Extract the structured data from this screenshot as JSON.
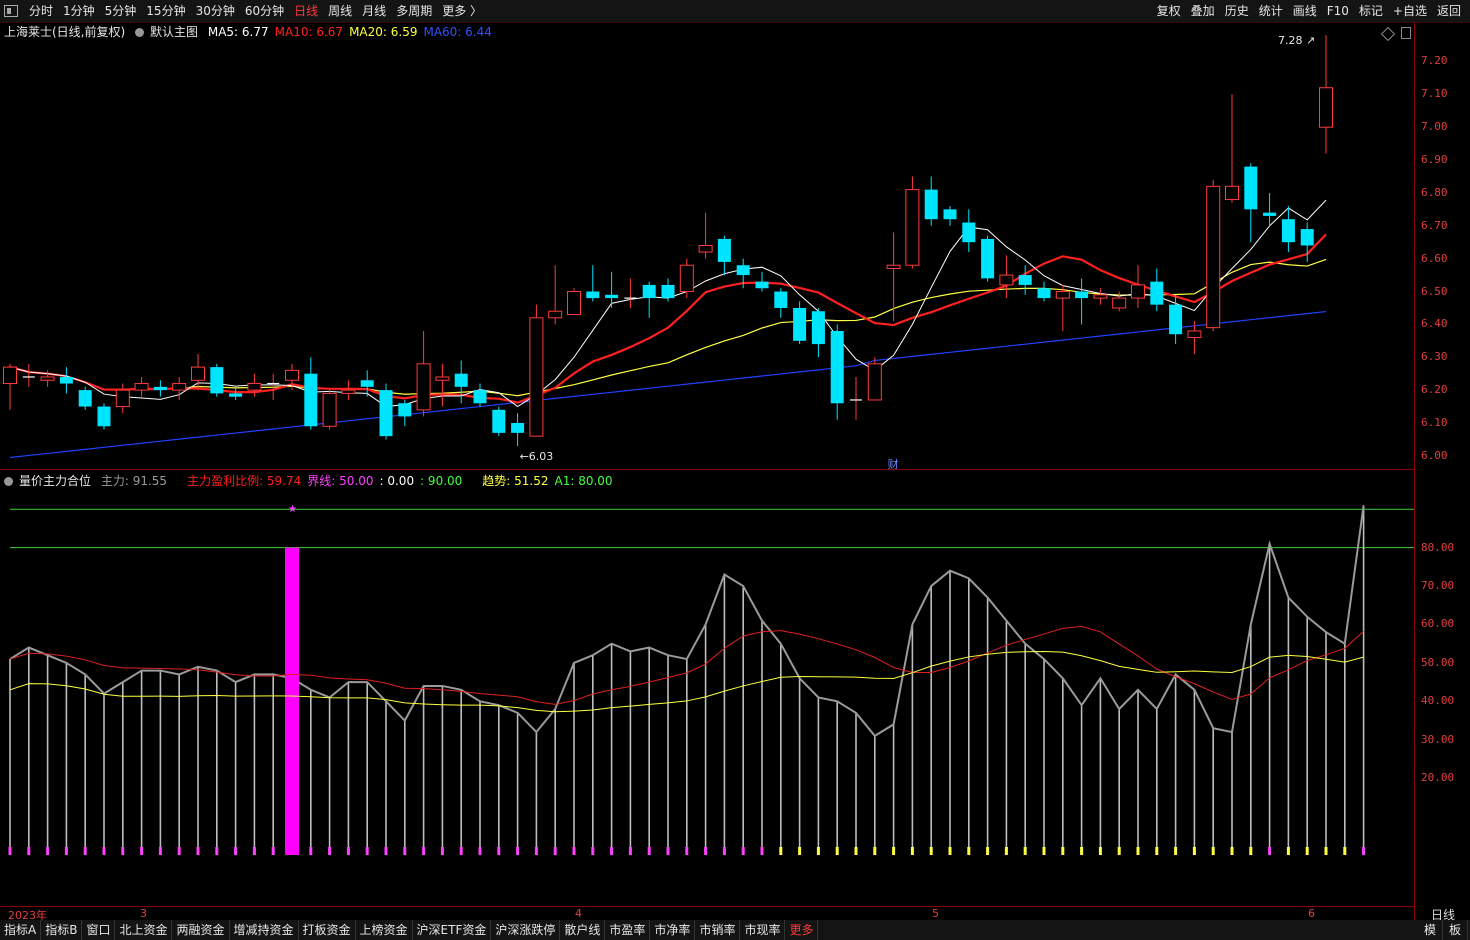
{
  "toolbar": {
    "periods": [
      "分时",
      "1分钟",
      "5分钟",
      "15分钟",
      "30分钟",
      "60分钟",
      "日线",
      "周线",
      "月线",
      "多周期",
      "更多 〉"
    ],
    "active_period": "日线",
    "right_buttons": [
      "复权",
      "叠加",
      "历史",
      "统计",
      "画线",
      "F10",
      "标记",
      "+自选",
      "返回"
    ]
  },
  "price_panel": {
    "stock_title": "上海莱士(日线,前复权)",
    "template": "默认主图",
    "ma": [
      {
        "label": "MA5: 6.77",
        "color": "#ffffff"
      },
      {
        "label": "MA10: 6.67",
        "color": "#ff2020"
      },
      {
        "label": "MA20: 6.59",
        "color": "#ffff40"
      },
      {
        "label": "MA60: 6.44",
        "color": "#3050ff"
      }
    ],
    "high_label": "7.28",
    "low_label": "6.03",
    "finance_marker": "财",
    "y_ticks": [
      "7.20",
      "7.10",
      "7.00",
      "6.90",
      "6.80",
      "6.70",
      "6.60",
      "6.50",
      "6.40",
      "6.30",
      "6.20",
      "6.10",
      "6.00"
    ]
  },
  "indicator_panel": {
    "name": "量价主力合位",
    "items": [
      {
        "label": "主力: 91.55",
        "color": "#9a9a9a"
      },
      {
        "label": "主力盈利比例: 59.74",
        "color": "#ff2020"
      },
      {
        "label": "界线: 50.00",
        "color": "#ff40ff"
      },
      {
        "label": ": 0.00",
        "color": "#ffffff"
      },
      {
        "label": ": 90.00",
        "color": "#40ff40"
      },
      {
        "label": "趋势: 51.52",
        "color": "#ffff40"
      },
      {
        "label": "A1: 80.00",
        "color": "#40ff40"
      }
    ],
    "y_ticks": [
      "80.00",
      "70.00",
      "60.00",
      "50.00",
      "40.00",
      "30.00",
      "20.00"
    ]
  },
  "dates": {
    "labels": [
      {
        "text": "2023年"
      },
      {
        "text": "3"
      },
      {
        "text": "4"
      },
      {
        "text": "5"
      },
      {
        "text": "6"
      }
    ],
    "period": "日线"
  },
  "bottom_bar": {
    "items": [
      "指标A",
      "指标B",
      "窗口",
      "北上资金",
      "两融资金",
      "增减持资金",
      "打板资金",
      "上榜资金",
      "沪深ETF资金",
      "沪深涨跌停",
      "散户线",
      "市盈率",
      "市净率",
      "市销率",
      "市现率",
      "更多"
    ],
    "right": [
      "模",
      "板"
    ]
  },
  "chart_data": [
    {
      "type": "candlestick",
      "title": "上海莱士(日线,前复权)",
      "ylim": [
        5.96,
        7.32
      ],
      "candles": [
        [
          6.22,
          6.27,
          6.14,
          6.28
        ],
        [
          6.24,
          6.24,
          6.21,
          6.28
        ],
        [
          6.23,
          6.24,
          6.21,
          6.26
        ],
        [
          6.24,
          6.22,
          6.19,
          6.27
        ],
        [
          6.2,
          6.15,
          6.14,
          6.21
        ],
        [
          6.15,
          6.09,
          6.08,
          6.16
        ],
        [
          6.15,
          6.2,
          6.13,
          6.22
        ],
        [
          6.2,
          6.22,
          6.18,
          6.24
        ],
        [
          6.21,
          6.2,
          6.18,
          6.23
        ],
        [
          6.2,
          6.22,
          6.17,
          6.24
        ],
        [
          6.23,
          6.27,
          6.2,
          6.31
        ],
        [
          6.27,
          6.19,
          6.18,
          6.28
        ],
        [
          6.19,
          6.18,
          6.17,
          6.21
        ],
        [
          6.2,
          6.22,
          6.18,
          6.25
        ],
        [
          6.22,
          6.22,
          6.17,
          6.25
        ],
        [
          6.23,
          6.26,
          6.2,
          6.28
        ],
        [
          6.25,
          6.09,
          6.08,
          6.3
        ],
        [
          6.09,
          6.19,
          6.08,
          6.2
        ],
        [
          6.19,
          6.2,
          6.17,
          6.23
        ],
        [
          6.23,
          6.21,
          6.18,
          6.26
        ],
        [
          6.2,
          6.06,
          6.05,
          6.22
        ],
        [
          6.16,
          6.12,
          6.09,
          6.17
        ],
        [
          6.14,
          6.28,
          6.12,
          6.38
        ],
        [
          6.23,
          6.24,
          6.15,
          6.28
        ],
        [
          6.25,
          6.21,
          6.16,
          6.29
        ],
        [
          6.2,
          6.16,
          6.15,
          6.22
        ],
        [
          6.14,
          6.07,
          6.06,
          6.15
        ],
        [
          6.1,
          6.07,
          6.03,
          6.13
        ],
        [
          6.06,
          6.42,
          6.06,
          6.46
        ],
        [
          6.42,
          6.44,
          6.4,
          6.58
        ],
        [
          6.43,
          6.5,
          6.44,
          6.51
        ],
        [
          6.5,
          6.48,
          6.47,
          6.58
        ],
        [
          6.49,
          6.48,
          6.45,
          6.56
        ],
        [
          6.48,
          6.48,
          6.45,
          6.54
        ],
        [
          6.52,
          6.48,
          6.42,
          6.53
        ],
        [
          6.52,
          6.48,
          6.47,
          6.54
        ],
        [
          6.5,
          6.58,
          6.48,
          6.6
        ],
        [
          6.62,
          6.64,
          6.6,
          6.74
        ],
        [
          6.66,
          6.59,
          6.55,
          6.67
        ],
        [
          6.58,
          6.55,
          6.51,
          6.6
        ],
        [
          6.53,
          6.51,
          6.5,
          6.56
        ],
        [
          6.5,
          6.45,
          6.42,
          6.51
        ],
        [
          6.45,
          6.35,
          6.34,
          6.47
        ],
        [
          6.44,
          6.34,
          6.3,
          6.45
        ],
        [
          6.38,
          6.16,
          6.11,
          6.4
        ],
        [
          6.17,
          6.17,
          6.11,
          6.24
        ],
        [
          6.17,
          6.28,
          6.17,
          6.3
        ],
        [
          6.57,
          6.58,
          6.41,
          6.68
        ],
        [
          6.58,
          6.81,
          6.57,
          6.85
        ],
        [
          6.81,
          6.72,
          6.7,
          6.85
        ],
        [
          6.75,
          6.72,
          6.7,
          6.76
        ],
        [
          6.71,
          6.65,
          6.62,
          6.75
        ],
        [
          6.66,
          6.54,
          6.53,
          6.67
        ],
        [
          6.52,
          6.55,
          6.48,
          6.61
        ],
        [
          6.55,
          6.52,
          6.49,
          6.58
        ],
        [
          6.51,
          6.48,
          6.47,
          6.53
        ],
        [
          6.48,
          6.5,
          6.38,
          6.52
        ],
        [
          6.5,
          6.48,
          6.4,
          6.54
        ],
        [
          6.48,
          6.49,
          6.46,
          6.51
        ],
        [
          6.45,
          6.48,
          6.44,
          6.5
        ],
        [
          6.48,
          6.52,
          6.45,
          6.58
        ],
        [
          6.53,
          6.46,
          6.44,
          6.57
        ],
        [
          6.46,
          6.37,
          6.34,
          6.49
        ],
        [
          6.36,
          6.38,
          6.31,
          6.41
        ],
        [
          6.39,
          6.82,
          6.38,
          6.84
        ],
        [
          6.78,
          6.82,
          6.77,
          7.1
        ],
        [
          6.88,
          6.75,
          6.65,
          6.89
        ],
        [
          6.74,
          6.73,
          6.7,
          6.8
        ],
        [
          6.72,
          6.65,
          6.62,
          6.76
        ],
        [
          6.69,
          6.64,
          6.59,
          6.71
        ],
        [
          7.0,
          7.12,
          6.92,
          7.28
        ]
      ]
    },
    {
      "type": "bar",
      "title": "量价主力合位",
      "ylim": [
        0,
        95
      ],
      "series": [
        {
          "name": "主力",
          "values": [
            51,
            54,
            52,
            50,
            47,
            42,
            45,
            48,
            48,
            47,
            49,
            48,
            45,
            47,
            47,
            46,
            43,
            41,
            45,
            45,
            40,
            35,
            44,
            44,
            43,
            40,
            39,
            37,
            32,
            38,
            50,
            52,
            55,
            53,
            54,
            52,
            51,
            60,
            73,
            70,
            61,
            55,
            46,
            41,
            40,
            37,
            31,
            34,
            60,
            70,
            74,
            72,
            67,
            61,
            55,
            51,
            46,
            39,
            46,
            38,
            43,
            38,
            47,
            43,
            33,
            32,
            60,
            81,
            67,
            62,
            58,
            55,
            91
          ]
        }
      ]
    }
  ]
}
